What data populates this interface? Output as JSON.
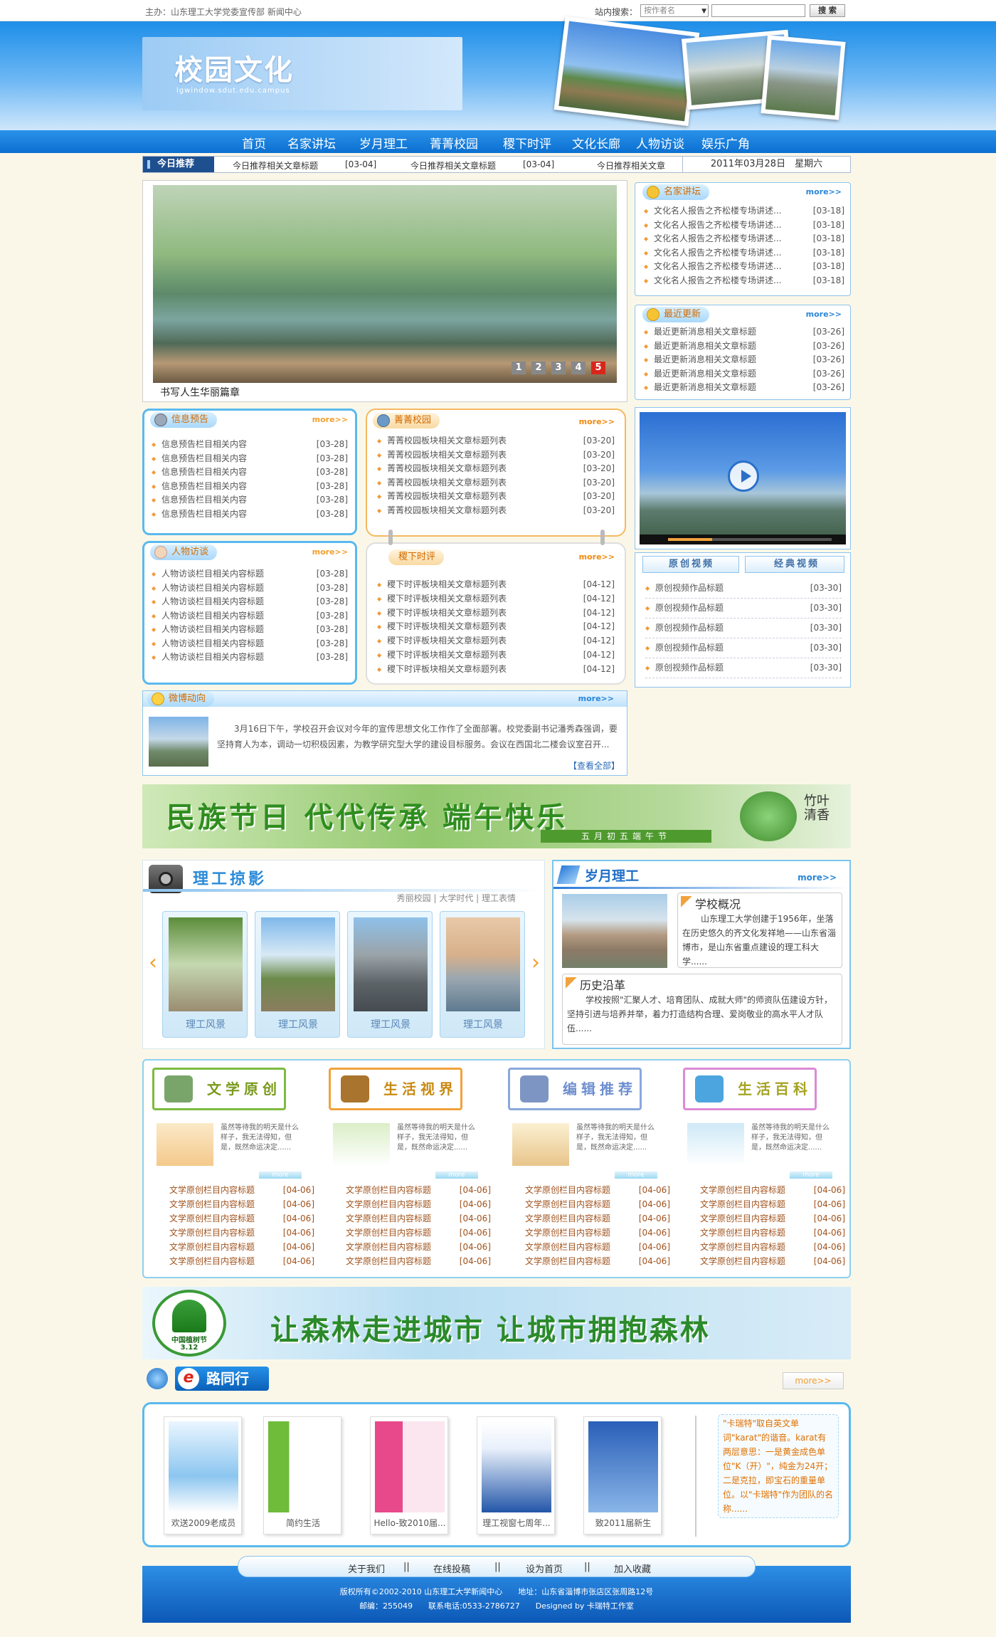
{
  "topbar": {
    "host": "主办：山东理工大学党委宣传部 新闻中心",
    "search_label": "站内搜索：",
    "search_option": "按作者名",
    "search_button": "搜 索"
  },
  "header": {
    "title": "校园文化",
    "subtitle": "lgwindow.sdut.edu.campus"
  },
  "nav": [
    "首页",
    "名家讲坛",
    "岁月理工",
    "菁菁校园",
    "稷下时评",
    "文化长廊",
    "人物访谈",
    "娱乐广角"
  ],
  "today": {
    "label": "今日推荐",
    "items": [
      {
        "title": "今日推荐相关文章标题",
        "date": "[03-04]"
      },
      {
        "title": "今日推荐相关文章标题",
        "date": "[03-04]"
      },
      {
        "title": "今日推荐相关文章"
      }
    ],
    "date": "2011年03月28日　星期六"
  },
  "slider": {
    "caption": "书写人生华丽篇章",
    "pages": [
      "1",
      "2",
      "3",
      "4",
      "5"
    ]
  },
  "lecture": {
    "title": "名家讲坛",
    "more": "more>>",
    "items": [
      {
        "t": "文化名人报告之齐松楼专场讲述...",
        "d": "[03-18]"
      },
      {
        "t": "文化名人报告之齐松楼专场讲述...",
        "d": "[03-18]"
      },
      {
        "t": "文化名人报告之齐松楼专场讲述...",
        "d": "[03-18]"
      },
      {
        "t": "文化名人报告之齐松楼专场讲述...",
        "d": "[03-18]"
      },
      {
        "t": "文化名人报告之齐松楼专场讲述...",
        "d": "[03-18]"
      },
      {
        "t": "文化名人报告之齐松楼专场讲述...",
        "d": "[03-18]"
      }
    ]
  },
  "latest": {
    "title": "最近更新",
    "more": "more>>",
    "items": [
      {
        "t": "最近更新消息相关文章标题",
        "d": "[03-26]"
      },
      {
        "t": "最近更新消息相关文章标题",
        "d": "[03-26]"
      },
      {
        "t": "最近更新消息相关文章标题",
        "d": "[03-26]"
      },
      {
        "t": "最近更新消息相关文章标题",
        "d": "[03-26]"
      },
      {
        "t": "最近更新消息相关文章标题",
        "d": "[03-26]"
      }
    ]
  },
  "info": {
    "title": "信息预告",
    "more": "more>>",
    "items": [
      {
        "t": "信息预告栏目相关内容",
        "d": "[03-28]"
      },
      {
        "t": "信息预告栏目相关内容",
        "d": "[03-28]"
      },
      {
        "t": "信息预告栏目相关内容",
        "d": "[03-28]"
      },
      {
        "t": "信息预告栏目相关内容",
        "d": "[03-28]"
      },
      {
        "t": "信息预告栏目相关内容",
        "d": "[03-28]"
      },
      {
        "t": "信息预告栏目相关内容",
        "d": "[03-28]"
      }
    ]
  },
  "campus": {
    "title": "菁菁校园",
    "more": "more>>",
    "items": [
      {
        "t": "菁菁校园板块相关文章标题列表",
        "d": "[03-20]"
      },
      {
        "t": "菁菁校园板块相关文章标题列表",
        "d": "[03-20]"
      },
      {
        "t": "菁菁校园板块相关文章标题列表",
        "d": "[03-20]"
      },
      {
        "t": "菁菁校园板块相关文章标题列表",
        "d": "[03-20]"
      },
      {
        "t": "菁菁校园板块相关文章标题列表",
        "d": "[03-20]"
      },
      {
        "t": "菁菁校园板块相关文章标题列表",
        "d": "[03-20]"
      }
    ]
  },
  "interview": {
    "title": "人物访谈",
    "more": "more>>",
    "items": [
      {
        "t": "人物访谈栏目相关内容标题",
        "d": "[03-28]"
      },
      {
        "t": "人物访谈栏目相关内容标题",
        "d": "[03-28]"
      },
      {
        "t": "人物访谈栏目相关内容标题",
        "d": "[03-28]"
      },
      {
        "t": "人物访谈栏目相关内容标题",
        "d": "[03-28]"
      },
      {
        "t": "人物访谈栏目相关内容标题",
        "d": "[03-28]"
      },
      {
        "t": "人物访谈栏目相关内容标题",
        "d": "[03-28]"
      },
      {
        "t": "人物访谈栏目相关内容标题",
        "d": "[03-28]"
      }
    ]
  },
  "comment": {
    "title": "稷下时评",
    "more": "more>>",
    "items": [
      {
        "t": "稷下时评板块相关文章标题列表",
        "d": "[04-12]"
      },
      {
        "t": "稷下时评板块相关文章标题列表",
        "d": "[04-12]"
      },
      {
        "t": "稷下时评板块相关文章标题列表",
        "d": "[04-12]"
      },
      {
        "t": "稷下时评板块相关文章标题列表",
        "d": "[04-12]"
      },
      {
        "t": "稷下时评板块相关文章标题列表",
        "d": "[04-12]"
      },
      {
        "t": "稷下时评板块相关文章标题列表",
        "d": "[04-12]"
      },
      {
        "t": "稷下时评板块相关文章标题列表",
        "d": "[04-12]"
      }
    ]
  },
  "video": {
    "tab1": "原创视频",
    "tab2": "经典视频",
    "items": [
      {
        "t": "原创视频作品标题",
        "d": "[03-30]"
      },
      {
        "t": "原创视频作品标题",
        "d": "[03-30]"
      },
      {
        "t": "原创视频作品标题",
        "d": "[03-30]"
      },
      {
        "t": "原创视频作品标题",
        "d": "[03-30]"
      },
      {
        "t": "原创视频作品标题",
        "d": "[03-30]"
      }
    ]
  },
  "weibo": {
    "title": "微博动向",
    "more": "more>>",
    "text": "3月16日下午，学校召开会议对今年的宣传思想文化工作作了全面部署。校党委副书记潘秀森强调，要坚持育人为本，调动一切积极因素，为教学研究型大学的建设目标服务。会议在西国北二楼会议室召开...",
    "view_all": "【查看全部】"
  },
  "banner1": {
    "text": "民族节日 代代传承 端午快乐",
    "sub": "五月初五端午节",
    "seal": "竹叶清香"
  },
  "photos": {
    "title": "理工掠影",
    "links": "秀丽校园 | 大学时代 | 理工表情",
    "captions": [
      "理工风景",
      "理工风景",
      "理工风景",
      "理工风景"
    ]
  },
  "years": {
    "title": "岁月理工",
    "more": "more>>",
    "overview_title": "学校概况",
    "overview_text": "山东理工大学创建于1956年，坐落在历史悠久的齐文化发祥地——山东省淄博市，是山东省重点建设的理工科大学......",
    "history_title": "历史沿革",
    "history_text": "学校按照\"汇聚人才、培育团队、成就大师\"的师资队伍建设方针，坚持引进与培养并举，着力打造结构合理、爱岗敬业的高水平人才队伍......"
  },
  "columns": [
    {
      "title": "文学原创",
      "color": "#7dbb3e",
      "titleColor": "#7a9a1c",
      "summary": "虽然等待我的明天是什么样子，我无法得知，但是，既然命运决定......",
      "more": "more"
    },
    {
      "title": "生活视界",
      "color": "#f1a23b",
      "titleColor": "#c98a12",
      "summary": "虽然等待我的明天是什么样子，我无法得知，但是，既然命运决定......",
      "more": "more"
    },
    {
      "title": "编辑推荐",
      "color": "#8aa8dc",
      "titleColor": "#6e8fcf",
      "summary": "虽然等待我的明天是什么样子，我无法得知，但是，既然命运决定......",
      "more": "more"
    },
    {
      "title": "生活百科",
      "color": "#dc8ad6",
      "titleColor": "#a4a322",
      "summary": "虽然等待我的明天是什么样子，我无法得知，但是，既然命运决定......",
      "more": "more"
    }
  ],
  "column_items": {
    "t": "文学原创栏目内容标题",
    "d": "[04-06]"
  },
  "banner2": {
    "text": "让森林走进城市 让城市拥抱森林",
    "badge": "中国植树节",
    "date": "3.12"
  },
  "elane": {
    "title": "路同行",
    "e": "e",
    "more": "more>>",
    "books": [
      "欢送2009老成员",
      "简约生活",
      "Hello-致2010届...",
      "理工视窗七周年...",
      "致2011届新生"
    ],
    "tip": "\"卡瑞特\"取自英文单词\"karat\"的谐音。karat有两层意思：一是黄金成色单位\"K（开）\"，纯金为24开；二是克拉，即宝石的重量单位。以\"卡瑞特\"作为团队的名称......"
  },
  "footer": {
    "links": [
      "关于我们",
      "在线投稿",
      "设为首页",
      "加入收藏"
    ],
    "sep": "||",
    "copy": "版权所有©2002-2010 山东理工大学新闻中心　　地址：山东省淄博市张店区张周路12号",
    "contact": "邮编：255049　　联系电话:0533-2786727　　Designed by 卡瑞特工作室"
  },
  "colors": {
    "primary": "#1278d6",
    "nav": "#0b6fd0",
    "accent": "#f29a36",
    "bg": "#fbf7e8"
  },
  "icons": {
    "list": "diamond-bullet",
    "video": "play-icon",
    "search": "search-icon"
  }
}
